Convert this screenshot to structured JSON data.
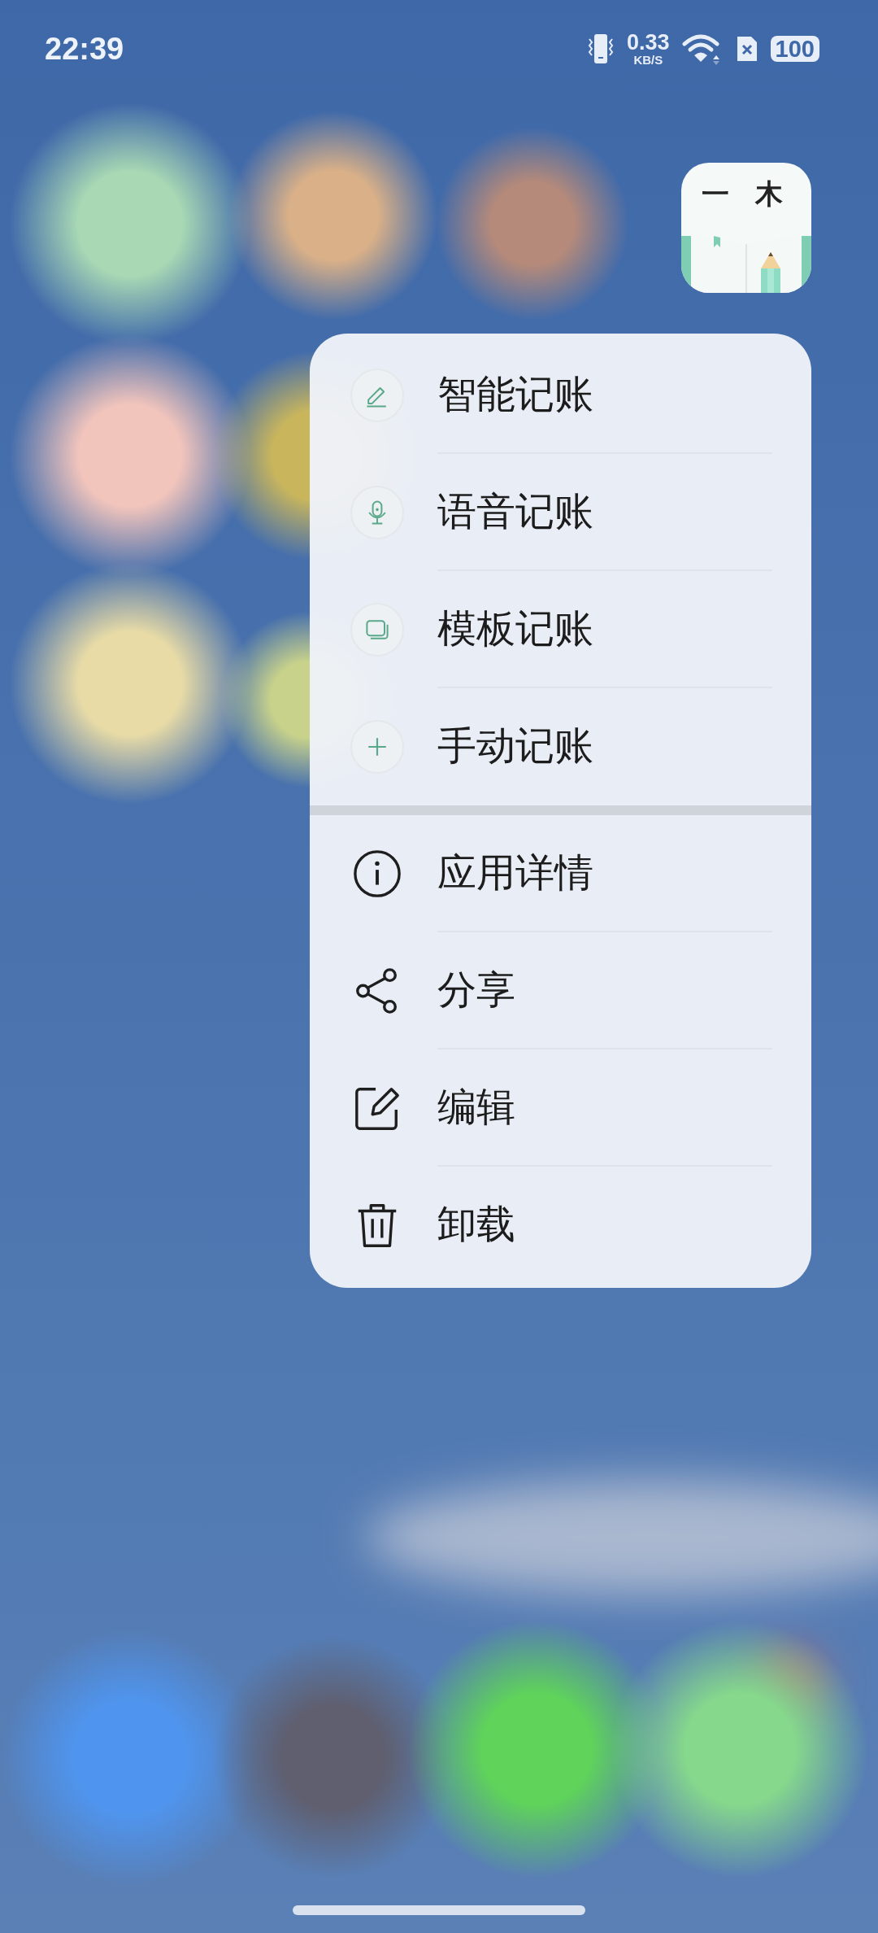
{
  "status_bar": {
    "time": "22:39",
    "speed_value": "0.33",
    "speed_unit": "KB/S",
    "battery": "100"
  },
  "app_icon": {
    "label": "一 木"
  },
  "quick_actions": [
    {
      "label": "智能记账"
    },
    {
      "label": "语音记账"
    },
    {
      "label": "模板记账"
    },
    {
      "label": "手动记账"
    }
  ],
  "system_actions": [
    {
      "label": "应用详情"
    },
    {
      "label": "分享"
    },
    {
      "label": "编辑"
    },
    {
      "label": "卸载"
    }
  ]
}
